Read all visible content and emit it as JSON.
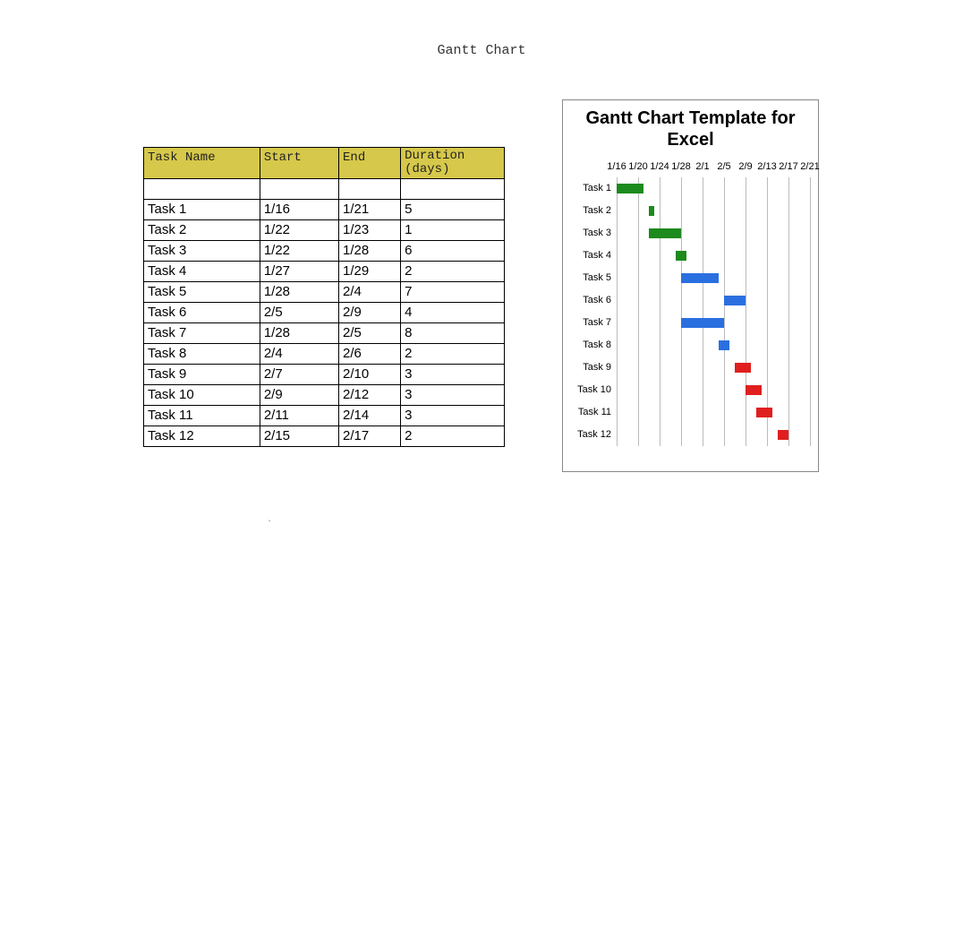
{
  "title": "Gantt Chart",
  "table": {
    "headers": {
      "name": "Task Name",
      "start": "Start",
      "end": "End",
      "duration": "Duration (days)"
    },
    "rows": [
      {
        "name": "Task 1",
        "start": "1/16",
        "end": "1/21",
        "duration": "5"
      },
      {
        "name": "Task 2",
        "start": "1/22",
        "end": "1/23",
        "duration": "1"
      },
      {
        "name": "Task 3",
        "start": "1/22",
        "end": "1/28",
        "duration": "6"
      },
      {
        "name": "Task 4",
        "start": "1/27",
        "end": "1/29",
        "duration": "2"
      },
      {
        "name": "Task 5",
        "start": "1/28",
        "end": "2/4",
        "duration": "7"
      },
      {
        "name": "Task 6",
        "start": "2/5",
        "end": "2/9",
        "duration": "4"
      },
      {
        "name": "Task 7",
        "start": "1/28",
        "end": "2/5",
        "duration": "8"
      },
      {
        "name": "Task 8",
        "start": "2/4",
        "end": "2/6",
        "duration": "2"
      },
      {
        "name": "Task 9",
        "start": "2/7",
        "end": "2/10",
        "duration": "3"
      },
      {
        "name": "Task 10",
        "start": "2/9",
        "end": "2/12",
        "duration": "3"
      },
      {
        "name": "Task 11",
        "start": "2/11",
        "end": "2/14",
        "duration": "3"
      },
      {
        "name": "Task 12",
        "start": "2/15",
        "end": "2/17",
        "duration": "2"
      }
    ]
  },
  "chart_data": {
    "type": "bar",
    "title": "Gantt Chart Template for Excel",
    "x_axis_ticks": [
      "1/16",
      "1/20",
      "1/24",
      "1/28",
      "2/1",
      "2/5",
      "2/9",
      "2/13",
      "2/17",
      "2/21"
    ],
    "x_axis_serial": [
      16,
      20,
      24,
      28,
      32,
      36,
      40,
      44,
      48,
      52
    ],
    "categories": [
      "Task 1",
      "Task 2",
      "Task 3",
      "Task 4",
      "Task 5",
      "Task 6",
      "Task 7",
      "Task 8",
      "Task 9",
      "Task 10",
      "Task 11",
      "Task 12"
    ],
    "bars": [
      {
        "task": "Task 1",
        "start_serial": 16,
        "duration": 5,
        "color": "green"
      },
      {
        "task": "Task 2",
        "start_serial": 22,
        "duration": 1,
        "color": "green"
      },
      {
        "task": "Task 3",
        "start_serial": 22,
        "duration": 6,
        "color": "green"
      },
      {
        "task": "Task 4",
        "start_serial": 27,
        "duration": 2,
        "color": "green"
      },
      {
        "task": "Task 5",
        "start_serial": 28,
        "duration": 7,
        "color": "blue"
      },
      {
        "task": "Task 6",
        "start_serial": 36,
        "duration": 4,
        "color": "blue"
      },
      {
        "task": "Task 7",
        "start_serial": 28,
        "duration": 8,
        "color": "blue"
      },
      {
        "task": "Task 8",
        "start_serial": 35,
        "duration": 2,
        "color": "blue"
      },
      {
        "task": "Task 9",
        "start_serial": 38,
        "duration": 3,
        "color": "red"
      },
      {
        "task": "Task 10",
        "start_serial": 40,
        "duration": 3,
        "color": "red"
      },
      {
        "task": "Task 11",
        "start_serial": 42,
        "duration": 3,
        "color": "red"
      },
      {
        "task": "Task 12",
        "start_serial": 46,
        "duration": 2,
        "color": "red"
      }
    ],
    "x_range": [
      16,
      52
    ]
  },
  "stray_mark": "`"
}
